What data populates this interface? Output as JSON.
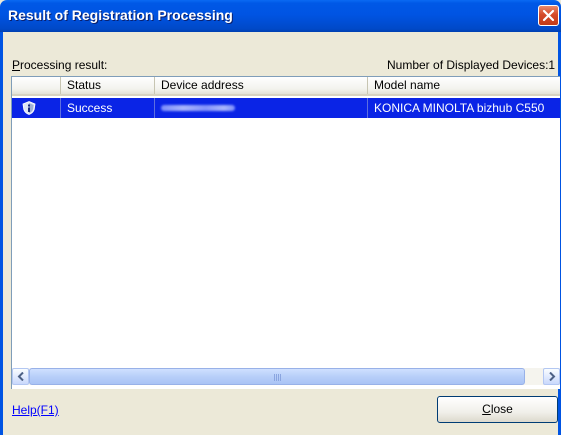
{
  "window": {
    "title": "Result of Registration Processing"
  },
  "labels": {
    "processing_result_mnemonic": "P",
    "processing_result_rest": "rocessing result:",
    "displayed_devices": "Number of Displayed Devices:1"
  },
  "table": {
    "columns": [
      "",
      "Status",
      "Device address",
      "Model name"
    ],
    "rows": [
      {
        "icon": "shield-info-icon",
        "status": "Success",
        "device_address": "",
        "model_name": "KONICA MINOLTA bizhub C550",
        "selected": true
      }
    ]
  },
  "footer": {
    "help_link": "Help(F1)",
    "close_mnemonic": "C",
    "close_rest": "lose"
  },
  "colors": {
    "title_bar": "#0054e3",
    "selection": "#0a24e6",
    "link": "#0000ff"
  }
}
